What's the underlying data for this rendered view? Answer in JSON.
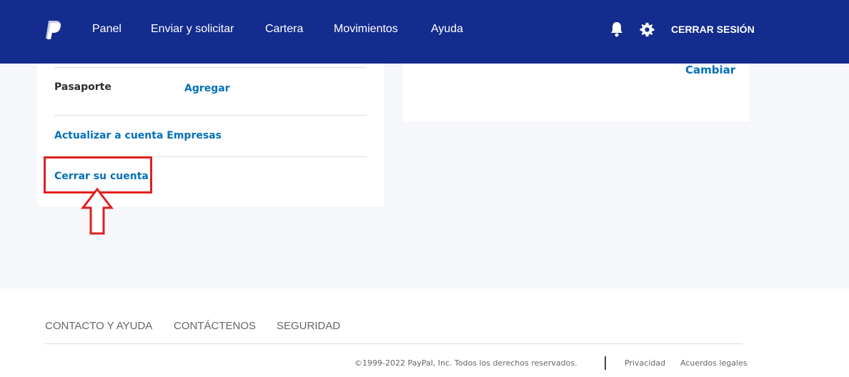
{
  "colors": {
    "header_bg": "#142c8e",
    "link": "#0070ba",
    "highlight": "#e0201e",
    "page_bg": "#f5f7fa"
  },
  "header": {
    "logo_icon": "paypal-logo",
    "nav": [
      "Panel",
      "Enviar y solicitar",
      "Cartera",
      "Movimientos",
      "Ayuda"
    ],
    "notifications_icon": "bell-icon",
    "settings_icon": "gear-icon",
    "logout_label": "CERRAR SESIÓN"
  },
  "account_card": {
    "passport_label": "Pasaporte",
    "passport_action": "Agregar",
    "upgrade_link": "Actualizar a cuenta Empresas",
    "close_account_link": "Cerrar su cuenta"
  },
  "side_card": {
    "change_link": "Cambiar"
  },
  "footer": {
    "links": [
      "CONTACTO Y AYUDA",
      "CONTÁCTENOS",
      "SEGURIDAD"
    ],
    "copyright": "©1999-2022 PayPal, Inc. Todos los derechos reservados.",
    "privacy": "Privacidad",
    "legal": "Acuerdos legales"
  }
}
